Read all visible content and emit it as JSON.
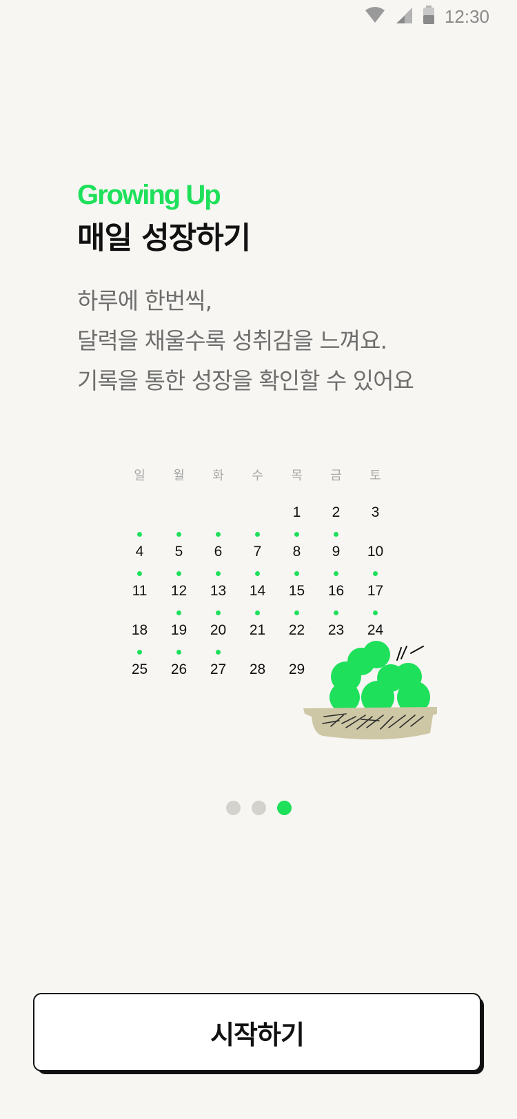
{
  "status_bar": {
    "time": "12:30",
    "icons": [
      "wifi-icon",
      "cell-signal-icon",
      "battery-icon"
    ]
  },
  "intro": {
    "subtitle": "Growing Up",
    "title": "매일 성장하기",
    "description": [
      "하루에 한번씩,",
      "달력을 채울수록 성취감을 느껴요.",
      "기록을 통한 성장을 확인할 수 있어요"
    ]
  },
  "calendar": {
    "weekdays": [
      "일",
      "월",
      "화",
      "수",
      "목",
      "금",
      "토"
    ],
    "weeks": [
      [
        null,
        null,
        null,
        null,
        {
          "day": "1",
          "done": false
        },
        {
          "day": "2",
          "done": false
        },
        {
          "day": "3",
          "done": false
        }
      ],
      [
        {
          "day": "4",
          "done": true
        },
        {
          "day": "5",
          "done": true
        },
        {
          "day": "6",
          "done": true
        },
        {
          "day": "7",
          "done": true
        },
        {
          "day": "8",
          "done": true
        },
        {
          "day": "9",
          "done": true
        },
        {
          "day": "10",
          "done": false
        }
      ],
      [
        {
          "day": "11",
          "done": true
        },
        {
          "day": "12",
          "done": true
        },
        {
          "day": "13",
          "done": true
        },
        {
          "day": "14",
          "done": true
        },
        {
          "day": "15",
          "done": true
        },
        {
          "day": "16",
          "done": true
        },
        {
          "day": "17",
          "done": true
        }
      ],
      [
        {
          "day": "18",
          "done": false
        },
        {
          "day": "19",
          "done": true
        },
        {
          "day": "20",
          "done": true
        },
        {
          "day": "21",
          "done": true
        },
        {
          "day": "22",
          "done": true
        },
        {
          "day": "23",
          "done": true
        },
        {
          "day": "24",
          "done": true
        }
      ],
      [
        {
          "day": "25",
          "done": true
        },
        {
          "day": "26",
          "done": true
        },
        {
          "day": "27",
          "done": true
        },
        {
          "day": "28",
          "done": false
        },
        {
          "day": "29",
          "done": false
        },
        null,
        null
      ]
    ]
  },
  "pager": {
    "count": 3,
    "active_index": 2
  },
  "start_button": {
    "label": "시작하기"
  },
  "colors": {
    "accent": "#1ee05a",
    "background": "#f7f6f2",
    "basket": "#cdc7a5"
  }
}
